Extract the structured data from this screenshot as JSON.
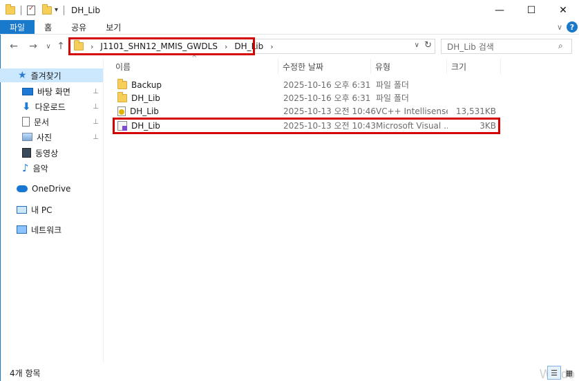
{
  "window": {
    "title": "DH_Lib",
    "minimize": "—",
    "maximize": "☐",
    "close": "✕"
  },
  "quick_access_toolbar": {
    "dropdown_glyph": "▾"
  },
  "ribbon": {
    "tabs": [
      "파일",
      "홈",
      "공유",
      "보기"
    ],
    "expand_glyph": "∨",
    "help_glyph": "?"
  },
  "navigation": {
    "back": "←",
    "forward": "→",
    "recent": "∨",
    "up": "↑"
  },
  "address_bar": {
    "breadcrumbs": [
      "J1101_SHN12_MMIS_GWDLS",
      "DH_Lib"
    ],
    "separator": "›",
    "dropdown_glyph": "∨",
    "refresh_glyph": "↻"
  },
  "search": {
    "placeholder": "DH_Lib 검색",
    "icon_glyph": "⌕"
  },
  "sidebar": {
    "items": [
      {
        "label": "즐겨찾기",
        "icon": "star-icon",
        "selected": true
      },
      {
        "label": "바탕 화면",
        "icon": "desktop-icon",
        "pinned": true
      },
      {
        "label": "다운로드",
        "icon": "download-icon",
        "pinned": true
      },
      {
        "label": "문서",
        "icon": "documents-icon",
        "pinned": true
      },
      {
        "label": "사진",
        "icon": "pictures-icon",
        "pinned": true
      },
      {
        "label": "동영상",
        "icon": "videos-icon"
      },
      {
        "label": "음악",
        "icon": "music-icon"
      },
      {
        "label": "OneDrive",
        "icon": "onedrive-icon"
      },
      {
        "label": "내 PC",
        "icon": "this-pc-icon"
      },
      {
        "label": "네트워크",
        "icon": "network-icon"
      }
    ],
    "pin_glyph": "📌"
  },
  "file_list": {
    "columns": [
      "이름",
      "수정한 날짜",
      "유형",
      "크기"
    ],
    "sort_glyph": "^",
    "rows": [
      {
        "name": "Backup",
        "date": "2025-10-16 오후 6:31",
        "type": "파일 폴더",
        "size": "",
        "icon": "folder-icon"
      },
      {
        "name": "DH_Lib",
        "date": "2025-10-16 오후 6:31",
        "type": "파일 폴더",
        "size": "",
        "icon": "folder-icon"
      },
      {
        "name": "DH_Lib",
        "date": "2025-10-13 오전 10:46",
        "type": "VC++ Intellisense...",
        "size": "13,531KB",
        "icon": "vc-db-file-icon"
      },
      {
        "name": "DH_Lib",
        "date": "2025-10-13 오전 10:43",
        "type": "Microsoft Visual ...",
        "size": "3KB",
        "icon": "solution-file-icon"
      }
    ]
  },
  "status_bar": {
    "item_count": "4개 항목",
    "watermark": "Windo"
  },
  "colors": {
    "accent": "#1979ca",
    "highlight_box": "#d40000",
    "sidebar_selected": "#cce8ff"
  }
}
